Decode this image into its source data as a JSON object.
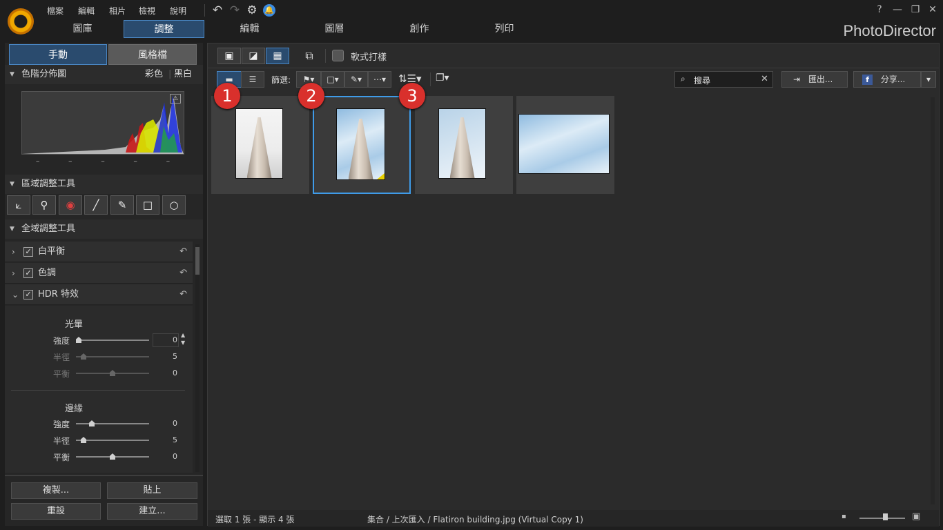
{
  "menu": [
    "檔案",
    "編輯",
    "相片",
    "檢視",
    "說明"
  ],
  "main_tabs": [
    {
      "label": "圖庫"
    },
    {
      "label": "調整",
      "active": true
    },
    {
      "label": "編輯"
    },
    {
      "label": "圖層"
    },
    {
      "label": "創作"
    },
    {
      "label": "列印"
    }
  ],
  "brand": "PhotoDirector",
  "window_controls": [
    "?",
    "—",
    "❐",
    "✕"
  ],
  "left": {
    "tabs": [
      "手動",
      "風格檔"
    ],
    "histogram": {
      "title": "色階分佈圖",
      "color": "彩色",
      "bw": "黑白",
      "readouts": [
        "–",
        "–",
        "–",
        "–",
        "–"
      ]
    },
    "regional": {
      "title": "區域調整工具"
    },
    "global": {
      "title": "全域調整工具"
    },
    "adjust_items": [
      {
        "label": "白平衡",
        "checked": true,
        "expanded": false
      },
      {
        "label": "色調",
        "checked": true,
        "expanded": false
      },
      {
        "label": "HDR 特效",
        "checked": true,
        "expanded": true
      }
    ],
    "glow": {
      "title": "光暈",
      "rows": [
        {
          "label": "強度",
          "value": "0",
          "pos": 0
        },
        {
          "label": "半徑",
          "value": "5",
          "pos": 0.1
        },
        {
          "label": "平衡",
          "value": "0",
          "pos": 0.5
        }
      ]
    },
    "edge": {
      "title": "邊緣",
      "rows": [
        {
          "label": "強度",
          "value": "0",
          "pos": 0.2
        },
        {
          "label": "半徑",
          "value": "5",
          "pos": 0.1
        },
        {
          "label": "平衡",
          "value": "0",
          "pos": 0.5
        }
      ]
    },
    "buttons": {
      "copy": "複製...",
      "paste": "貼上",
      "reset": "重設",
      "create": "建立..."
    }
  },
  "toolbar": {
    "softproof": "軟式打樣",
    "filter_label": "篩選:",
    "search_placeholder": "搜尋",
    "export": "匯出...",
    "share": "分享..."
  },
  "callouts": [
    "1",
    "2",
    "3"
  ],
  "photos": [
    {
      "name": "Flatiron building",
      "selected": false
    },
    {
      "name": "Flatiron building (Virtual Copy 1)",
      "selected": true
    },
    {
      "name": "Flatiron building",
      "selected": false
    },
    {
      "name": "sky",
      "selected": false
    }
  ],
  "status": {
    "left": "選取 1 張 - 顯示 4 張",
    "path": "集合 / 上次匯入 / Flatiron building.jpg (Virtual Copy 1)"
  }
}
